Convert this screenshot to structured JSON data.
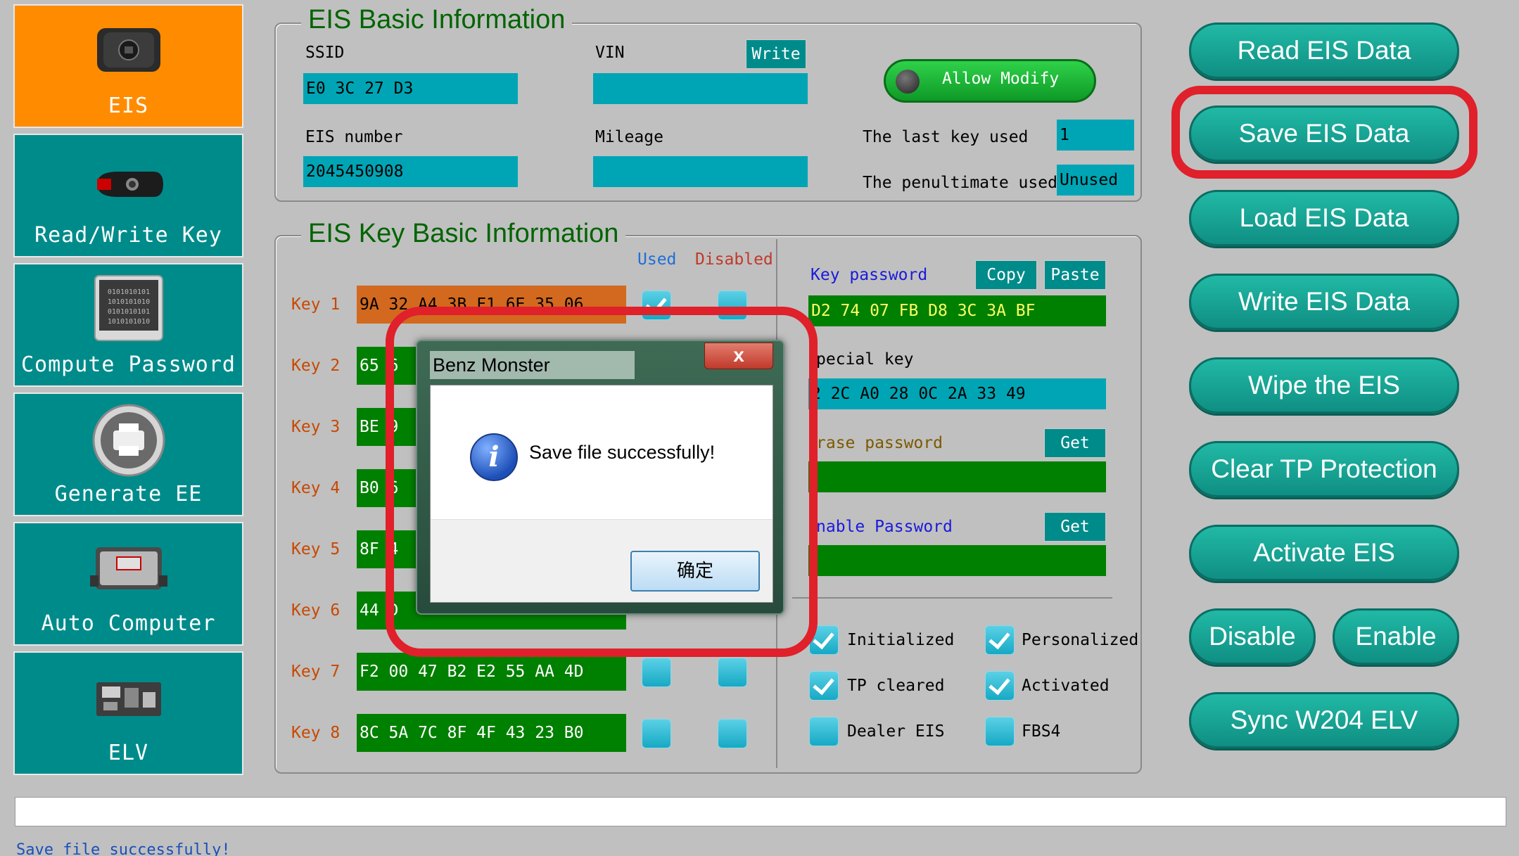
{
  "sidebar": {
    "items": [
      {
        "label": "EIS",
        "icon": "eis-module-icon",
        "active": true
      },
      {
        "label": "Read/Write Key",
        "icon": "car-key-icon",
        "active": false
      },
      {
        "label": "Compute Password",
        "icon": "binary-chip-icon",
        "active": false
      },
      {
        "label": "Generate EE",
        "icon": "printer-icon",
        "active": false
      },
      {
        "label": "Auto Computer",
        "icon": "ecu-icon",
        "active": false
      },
      {
        "label": "ELV",
        "icon": "circuit-board-icon",
        "active": false
      }
    ]
  },
  "eis_basic": {
    "title": "EIS Basic Information",
    "ssid_label": "SSID",
    "ssid_value": "E0  3C  27  D3",
    "vin_label": "VIN",
    "vin_value": "",
    "write_button": "Write",
    "allow_modify": "Allow Modify",
    "eis_number_label": "EIS number",
    "eis_number_value": "2045450908",
    "mileage_label": "Mileage",
    "mileage_value": "",
    "last_key_label": "The last key used",
    "last_key_value": "1",
    "penultimate_label": "The penultimate used",
    "penultimate_value": "Unused"
  },
  "key_basic": {
    "title": "EIS Key Basic Information",
    "used_header": "Used",
    "disabled_header": "Disabled",
    "keys": [
      {
        "label": "Key 1",
        "value": "9A  32  A4  3B  F1  6E  35  06",
        "used": true,
        "disabled": false
      },
      {
        "label": "Key 2",
        "value": "65  6",
        "used": false,
        "disabled": false
      },
      {
        "label": "Key 3",
        "value": "BE  9",
        "used": false,
        "disabled": false
      },
      {
        "label": "Key 4",
        "value": "B0  6",
        "used": false,
        "disabled": false
      },
      {
        "label": "Key 5",
        "value": "8F  4",
        "used": false,
        "disabled": false
      },
      {
        "label": "Key 6",
        "value": "44  D",
        "used": false,
        "disabled": false
      },
      {
        "label": "Key 7",
        "value": "F2  00  47  B2  E2  55  AA  4D",
        "used": false,
        "disabled": false
      },
      {
        "label": "Key 8",
        "value": "8C  5A  7C  8F  4F  43  23  B0",
        "used": false,
        "disabled": false
      }
    ],
    "key_password_label": "Key password",
    "copy_button": "Copy",
    "paste_button": "Paste",
    "key_password_value": "D2  74  07  FB  D8  3C  3A  BF",
    "special_key_label": "pecial key",
    "special_key_value": "2  2C  A0  28  0C  2A  33  49",
    "erase_password_label": "rase password",
    "erase_get": "Get",
    "erase_value": "",
    "enable_password_label": "nable Password",
    "enable_get": "Get",
    "enable_value": "",
    "flags": [
      {
        "label": "Initialized",
        "checked": true
      },
      {
        "label": "Personalized",
        "checked": true
      },
      {
        "label": "TP cleared",
        "checked": true
      },
      {
        "label": "Activated",
        "checked": true
      },
      {
        "label": "Dealer EIS",
        "checked": false
      },
      {
        "label": "FBS4",
        "checked": false
      }
    ]
  },
  "actions": {
    "read": "Read  EIS Data",
    "save": "Save EIS Data",
    "load": "Load EIS Data",
    "write": "Write EIS Data",
    "wipe": "Wipe the EIS",
    "clear_tp": "Clear TP Protection",
    "activate": "Activate EIS",
    "disable": "Disable",
    "enable": "Enable",
    "sync": "Sync W204 ELV"
  },
  "status": {
    "input_value": "",
    "message": "Save  file  successfully!"
  },
  "dialog": {
    "title": "Benz Monster",
    "close": "x",
    "message": "Save file successfully!",
    "ok": "确定",
    "icon": "info-icon"
  },
  "colors": {
    "teal": "#008b8b",
    "active": "#ff8c00",
    "highlight": "#e0202a",
    "field": "#00a5b5",
    "green": "#008000"
  }
}
